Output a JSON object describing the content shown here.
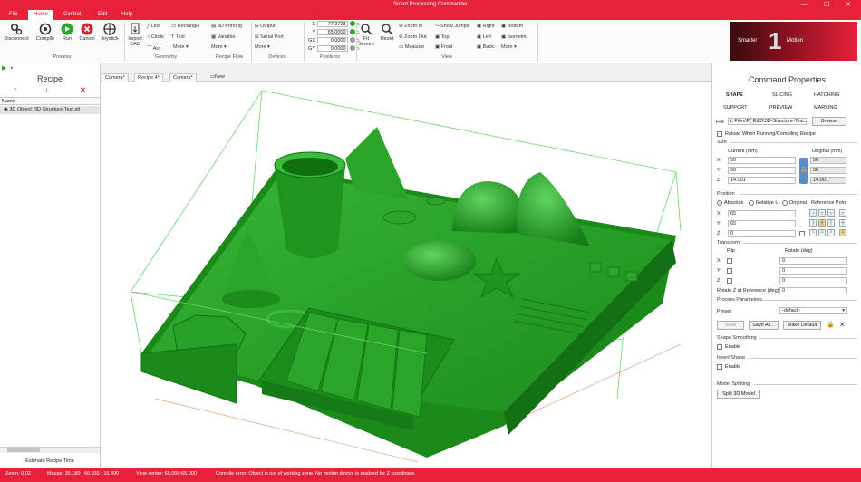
{
  "window": {
    "title": "Smart Processing Commander"
  },
  "menus": [
    "File",
    "Home",
    "Control",
    "Edit",
    "Help"
  ],
  "ribbon": {
    "process": {
      "items": [
        "Disconnect",
        "Compile",
        "Run",
        "Cancel",
        "Joystick"
      ],
      "label": "Process"
    },
    "geometry": {
      "import_cad": "Import CAD",
      "line": "Line",
      "circle": "Circle",
      "arc": "Arc",
      "rectangle": "Rectangle",
      "text": "Text",
      "more": "More ▾",
      "label": "Geometry"
    },
    "recipe_flow": {
      "printing": "3D Printing",
      "variable": "Variable",
      "more": "More ▾",
      "label": "Recipe Flow"
    },
    "devices": {
      "output": "Output",
      "serial_port": "Serial Port",
      "more": "More ▾",
      "label": "Devices"
    },
    "positions": {
      "rows": [
        {
          "axis": "X",
          "value": "77.2723"
        },
        {
          "axis": "Y",
          "value": "65.0000"
        },
        {
          "axis": "GX",
          "value": "0.0000"
        },
        {
          "axis": "GY",
          "value": "0.0000"
        }
      ],
      "label": "Positions"
    },
    "view": {
      "fit_screen": "Fit Screen",
      "reset": "Reset",
      "zoom_in": "Zoom In",
      "zoom_out": "Zoom Out",
      "measure": "Measure",
      "show_jumps": "Show Jumps",
      "top": "Top",
      "front": "Front",
      "right": "Right",
      "left": "Left",
      "back": "Back",
      "bottom": "Bottom",
      "isometric": "Isometric",
      "more": "More ▾",
      "label": "View"
    },
    "logo_text_left": "Smarter",
    "logo_text_right": "Motion"
  },
  "recipe_panel": {
    "title": "Recipe",
    "column_header": "Name",
    "items": [
      "3D Object: 3D-Structure-Test.stl"
    ],
    "estimate_button": "Estimate Recipe Time"
  },
  "doc_tabs": [
    "Camera*",
    "Recipe 4*",
    "Camera*",
    "New"
  ],
  "properties": {
    "title": "Command Properties",
    "tabs_row1": [
      "SHAPE",
      "SLICING",
      "HATCHING"
    ],
    "tabs_row2": [
      "SUPPORT",
      "PREVIEW",
      "MARKING"
    ],
    "file_label": "File",
    "file_value": "L Files\\P( R&D\\3D-Structure-Test.st",
    "browse": "Browse",
    "reload": "Reload When Running/Compiling Recipe",
    "size": {
      "label": "Size",
      "current_header": "Current (mm)",
      "original_header": "Original (mm)",
      "rows": [
        {
          "axis": "X",
          "current": "50",
          "original": "50"
        },
        {
          "axis": "Y",
          "current": "50",
          "original": "50"
        },
        {
          "axis": "Z",
          "current": "14.001",
          "original": "14.001"
        }
      ]
    },
    "position": {
      "label": "Position",
      "absolute": "Absolute",
      "relative": "Relative L•",
      "original": "Original",
      "ref_point": "Reference Point",
      "rows": [
        {
          "axis": "X",
          "value": "65"
        },
        {
          "axis": "Y",
          "value": "65"
        },
        {
          "axis": "Z",
          "value": "0"
        }
      ]
    },
    "transform": {
      "label": "Transform",
      "flip": "Flip",
      "rotate": "Rotate (deg)",
      "rows": [
        {
          "axis": "X",
          "value": "0"
        },
        {
          "axis": "Y",
          "value": "0"
        },
        {
          "axis": "Z",
          "value": "0"
        }
      ],
      "rotate_z_label": "Rotate Z at Reference (deg)",
      "rotate_z_value": "0"
    },
    "process_params": {
      "label": "Process Parameters",
      "preset_label": "Preset",
      "preset_value": "-default-"
    },
    "buttons": {
      "save": "Save",
      "save_as": "Save As...",
      "make_default": "Make Default"
    },
    "smoothing": {
      "label": "Shape Smoothing",
      "enable": "Enable"
    },
    "invert": {
      "label": "Invert Shape",
      "enable": "Enable"
    },
    "splitting": {
      "label": "Model Splitting",
      "button": "Split 3D Model"
    }
  },
  "status": {
    "zoom": "Zoom: 0.02",
    "mouse": "Mouse: 35.180 : 66.935 : 15.490",
    "view_center": "View center: 65.000:65.000",
    "error": "Compile error: Object is out of working zone. No motion device is enabled for Z coordinate."
  },
  "colors": {
    "accent": "#e8203a",
    "model": "#1f9a1f",
    "bbox": "#6fd36f"
  }
}
